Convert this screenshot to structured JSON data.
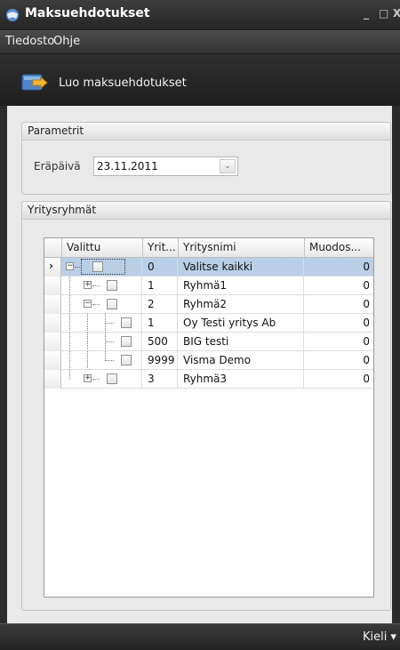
{
  "window": {
    "title": "Maksuehdotukset",
    "min": "_",
    "max": "□",
    "close": "X"
  },
  "menu": {
    "file": "Tiedosto",
    "help": "Ohje"
  },
  "toolbar": {
    "create_label": "Luo maksuehdotukset"
  },
  "params": {
    "header": "Parametrit",
    "due_label": "Eräpäivä",
    "due_value": "23.11.2011",
    "drop_glyph": "⌄"
  },
  "groups": {
    "header": "Yritysryhmät",
    "columns": {
      "selected": "Valittu",
      "id": "Yrit...",
      "name": "Yritysnimi",
      "modified": "Muodos..."
    },
    "rows": [
      {
        "id": "0",
        "name": "Valitse kaikki",
        "modified": "0"
      },
      {
        "id": "1",
        "name": "Ryhmä1",
        "modified": "0"
      },
      {
        "id": "2",
        "name": "Ryhmä2",
        "modified": "0"
      },
      {
        "id": "1",
        "name": "Oy Testi yritys Ab",
        "modified": "0"
      },
      {
        "id": "500",
        "name": "BIG testi",
        "modified": "0"
      },
      {
        "id": "9999",
        "name": "Visma Demo",
        "modified": "0"
      },
      {
        "id": "3",
        "name": "Ryhmä3",
        "modified": "0"
      }
    ]
  },
  "statusbar": {
    "language": "Kieli ▾"
  }
}
